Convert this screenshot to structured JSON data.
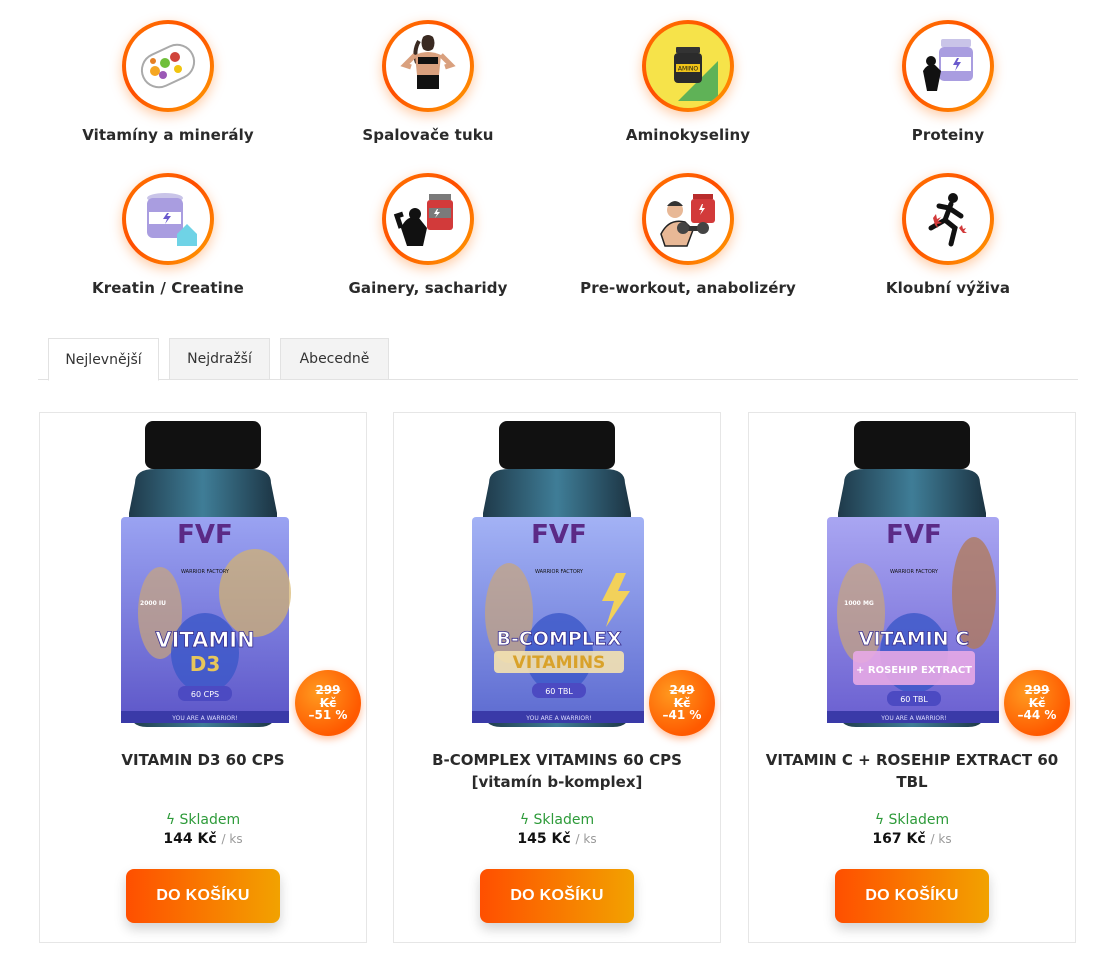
{
  "categories": [
    {
      "label": "Vitamíny a minerály",
      "icon": "vitamins-capsule-icon"
    },
    {
      "label": "Spalovače tuku",
      "icon": "fit-woman-icon"
    },
    {
      "label": "Aminokyseliny",
      "icon": "amino-jar-icon"
    },
    {
      "label": "Proteiny",
      "icon": "protein-tub-icon"
    },
    {
      "label": "Kreatin / Creatine",
      "icon": "creatine-tub-icon"
    },
    {
      "label": "Gainery, sacharidy",
      "icon": "gainer-icon"
    },
    {
      "label": "Pre-workout, anabolizéry",
      "icon": "preworkout-icon"
    },
    {
      "label": "Kloubní výživa",
      "icon": "running-woman-icon"
    }
  ],
  "tabs": [
    {
      "label": "Nejlevnější",
      "active": true
    },
    {
      "label": "Nejdražší",
      "active": false
    },
    {
      "label": "Abecedně",
      "active": false
    }
  ],
  "products": [
    {
      "name": "VITAMIN D3 60 CPS",
      "label_line1": "VITAMIN",
      "label_line2": "D3",
      "label_count": "60 CPS",
      "label_dose": "2000 IU",
      "brand": "WARRIOR FACTORY",
      "slogan": "YOU ARE A WARRIOR!",
      "old_price": "299",
      "currency_badge": "Kč",
      "discount": "–51 %",
      "stock": "ϟ Skladem",
      "price": "144 Kč",
      "unit": "/ ks",
      "button": "DO KOŠÍKU",
      "label_color": "#7d86e8"
    },
    {
      "name": "B-COMPLEX VITAMINS 60 CPS [vitamín b-komplex]",
      "label_line1": "B-COMPLEX",
      "label_line2": "VITAMINS",
      "label_count": "60 TBL",
      "label_dose": "",
      "brand": "WARRIOR FACTORY",
      "slogan": "YOU ARE A WARRIOR!",
      "old_price": "249",
      "currency_badge": "Kč",
      "discount": "–41 %",
      "stock": "ϟ Skladem",
      "price": "145 Kč",
      "unit": "/ ks",
      "button": "DO KOŠÍKU",
      "label_color": "#7a8ff0"
    },
    {
      "name": "VITAMIN C + ROSEHIP EXTRACT 60 TBL",
      "label_line1": "VITAMIN C",
      "label_line2": "+ ROSEHIP EXTRACT",
      "label_count": "60 TBL",
      "label_dose": "1000 MG",
      "brand": "WARRIOR FACTORY",
      "slogan": "YOU ARE A WARRIOR!",
      "old_price": "299",
      "currency_badge": "Kč",
      "discount": "–44 %",
      "stock": "ϟ Skladem",
      "price": "167 Kč",
      "unit": "/ ks",
      "button": "DO KOŠÍKU",
      "label_color": "#8b86e6"
    }
  ],
  "colors": {
    "accent": "#ff5a00",
    "accent2": "#f2a200",
    "stock": "#2e9b3a"
  }
}
